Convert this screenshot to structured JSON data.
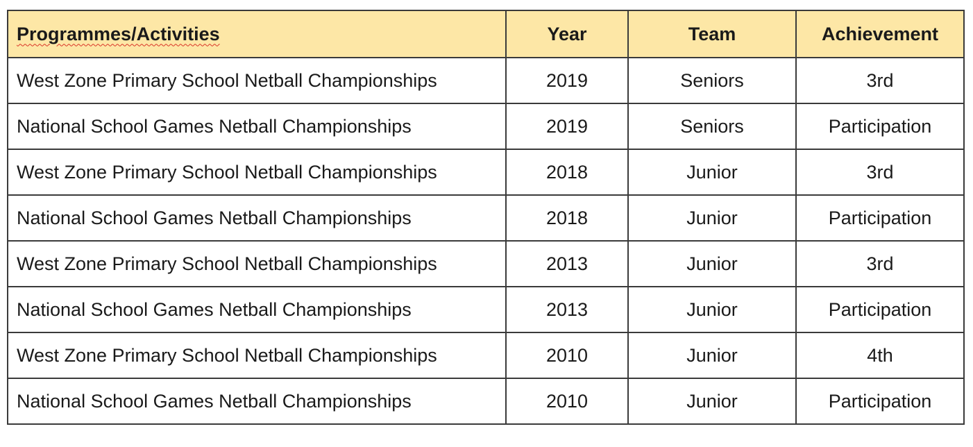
{
  "table": {
    "header_background": "#fde7a6",
    "headers": [
      "Programmes/Activities",
      "Year",
      "Team",
      "Achievement"
    ],
    "rows": [
      [
        "West Zone Primary School Netball Championships",
        "2019",
        "Seniors",
        "3rd"
      ],
      [
        "National School Games Netball Championships",
        "2019",
        "Seniors",
        "Participation"
      ],
      [
        "West Zone Primary School Netball Championships",
        "2018",
        "Junior",
        "3rd"
      ],
      [
        "National School Games Netball Championships",
        "2018",
        "Junior",
        "Participation"
      ],
      [
        "West Zone Primary School Netball Championships",
        "2013",
        "Junior",
        "3rd"
      ],
      [
        "National School Games Netball Championships",
        "2013",
        "Junior",
        "Participation"
      ],
      [
        "West Zone Primary School Netball Championships",
        "2010",
        "Junior",
        "4th"
      ],
      [
        "National School Games Netball Championships",
        "2010",
        "Junior",
        "Participation"
      ]
    ]
  }
}
